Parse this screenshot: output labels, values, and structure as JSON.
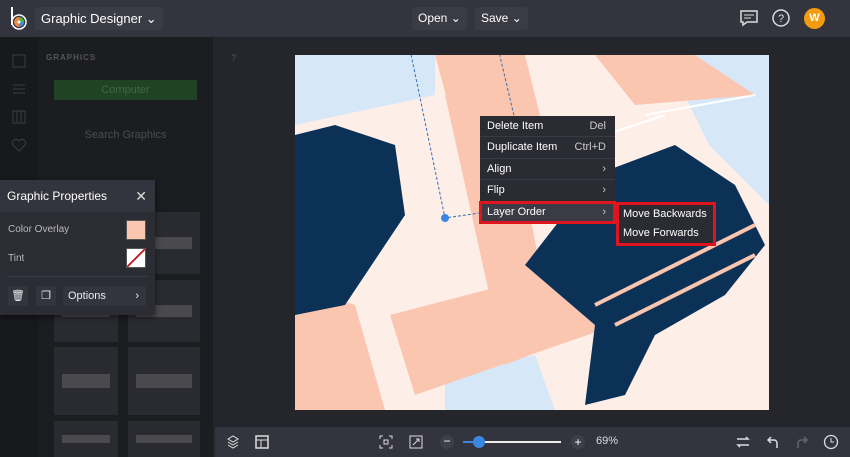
{
  "topbar": {
    "app_name": "Graphic Designer",
    "open_label": "Open",
    "save_label": "Save",
    "avatar_initial": "W"
  },
  "left_panel": {
    "title": "GRAPHICS",
    "computer_button": "Computer",
    "search_placeholder": "Search Graphics"
  },
  "properties": {
    "title": "Graphic Properties",
    "color_overlay_label": "Color Overlay",
    "color_overlay_value": "#fbc6b0",
    "tint_label": "Tint",
    "options_label": "Options"
  },
  "context_menu": {
    "items": [
      {
        "label": "Delete Item",
        "shortcut": "Del"
      },
      {
        "label": "Duplicate Item",
        "shortcut": "Ctrl+D"
      },
      {
        "label": "Align",
        "shortcut": "›"
      },
      {
        "label": "Flip",
        "shortcut": "›"
      },
      {
        "label": "Layer Order",
        "shortcut": "›"
      }
    ],
    "submenu": [
      "Move Backwards",
      "Move Forwards"
    ]
  },
  "bottombar": {
    "zoom_percent": 69,
    "zoom_label": "69%"
  },
  "colors": {
    "accent": "#3a86e0",
    "highlight": "#e0141c",
    "navy": "#0b3157",
    "peach": "#fbc6b0",
    "light_blue": "#d6e8f8"
  }
}
